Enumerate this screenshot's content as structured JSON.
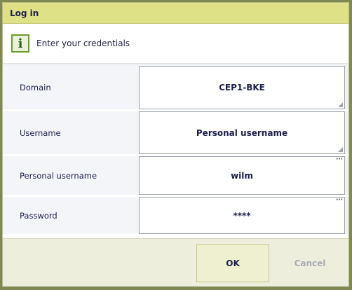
{
  "dialog": {
    "title": "Log in",
    "info_message": "Enter your credentials"
  },
  "fields": [
    {
      "label": "Domain",
      "value": "CEP1-BKE"
    },
    {
      "label": "Username",
      "value": "Personal username"
    },
    {
      "label": "Personal username",
      "value": "wilm"
    },
    {
      "label": "Password",
      "value": "****"
    }
  ],
  "buttons": {
    "ok": "OK",
    "cancel": "Cancel"
  },
  "colors": {
    "titlebar": "#dfe187",
    "footer": "#eeeedc",
    "text": "#1b1e4b"
  }
}
